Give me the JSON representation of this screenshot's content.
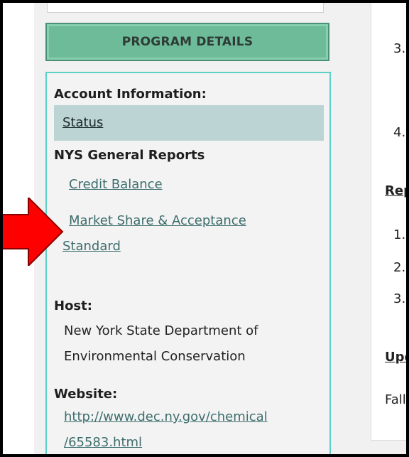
{
  "program_details_button": "PROGRAM DETAILS",
  "account_information": {
    "heading": "Account Information:",
    "status_link": "Status"
  },
  "nys_general_reports": {
    "heading": "NYS General Reports",
    "credit_balance_link": "Credit Balance",
    "market_share_link_line1": "Market Share & Acceptance",
    "market_share_link_line2": "Standard"
  },
  "host": {
    "heading": "Host:",
    "line1": "New York State Department of",
    "line2": "Environmental Conservation"
  },
  "website": {
    "heading": "Website:",
    "url_line1": "http://www.dec.ny.gov/chemical",
    "url_line2": "/65583.html"
  },
  "right_panel": {
    "num3_top": "3.",
    "num4": "4.",
    "rep_heading": "Rep",
    "num1": "1.",
    "num2": "2.",
    "num3": "3.",
    "upd_heading": "Upd",
    "fall_text": "Fall"
  },
  "colors": {
    "button_green": "#6dbb98",
    "panel_border": "#5cd1c8",
    "status_bg": "#bcd4d4",
    "arrow_red": "#ff0000",
    "link": "#3e6d6d"
  }
}
